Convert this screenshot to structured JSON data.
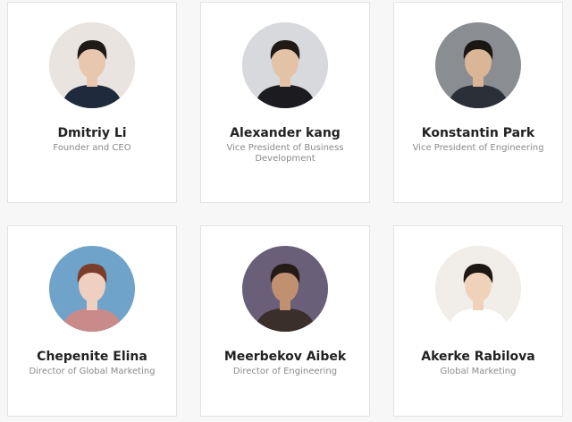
{
  "team": [
    {
      "name": "Dmitriy Li",
      "title": "Founder and CEO",
      "avatar_bg": "#e9e4df",
      "skin": "#e8c7ae",
      "hair": "#1e1a18",
      "shirt": "#1f2b3c"
    },
    {
      "name": "Alexander kang",
      "title": "Vice President of Business Development",
      "avatar_bg": "#d7d9dd",
      "skin": "#e4c2a6",
      "hair": "#201a17",
      "shirt": "#1c1c20"
    },
    {
      "name": "Konstantin Park",
      "title": "Vice President of Engineering",
      "avatar_bg": "#8a8d92",
      "skin": "#dab696",
      "hair": "#1a1614",
      "shirt": "#2b2f38"
    },
    {
      "name": "Chepenite Elina",
      "title": "Director of Global Marketing",
      "avatar_bg": "#6fa3c9",
      "skin": "#efcfc0",
      "hair": "#7a3d2a",
      "shirt": "#c98a8a"
    },
    {
      "name": "Meerbekov Aibek",
      "title": "Director of Engineering",
      "avatar_bg": "#6a5f78",
      "skin": "#c09070",
      "hair": "#241b17",
      "shirt": "#3a2f2a"
    },
    {
      "name": "Akerke Rabilova",
      "title": "Global Marketing",
      "avatar_bg": "#f1ede9",
      "skin": "#f0d2bb",
      "hair": "#1c1614",
      "shirt": "#ffffff"
    }
  ]
}
